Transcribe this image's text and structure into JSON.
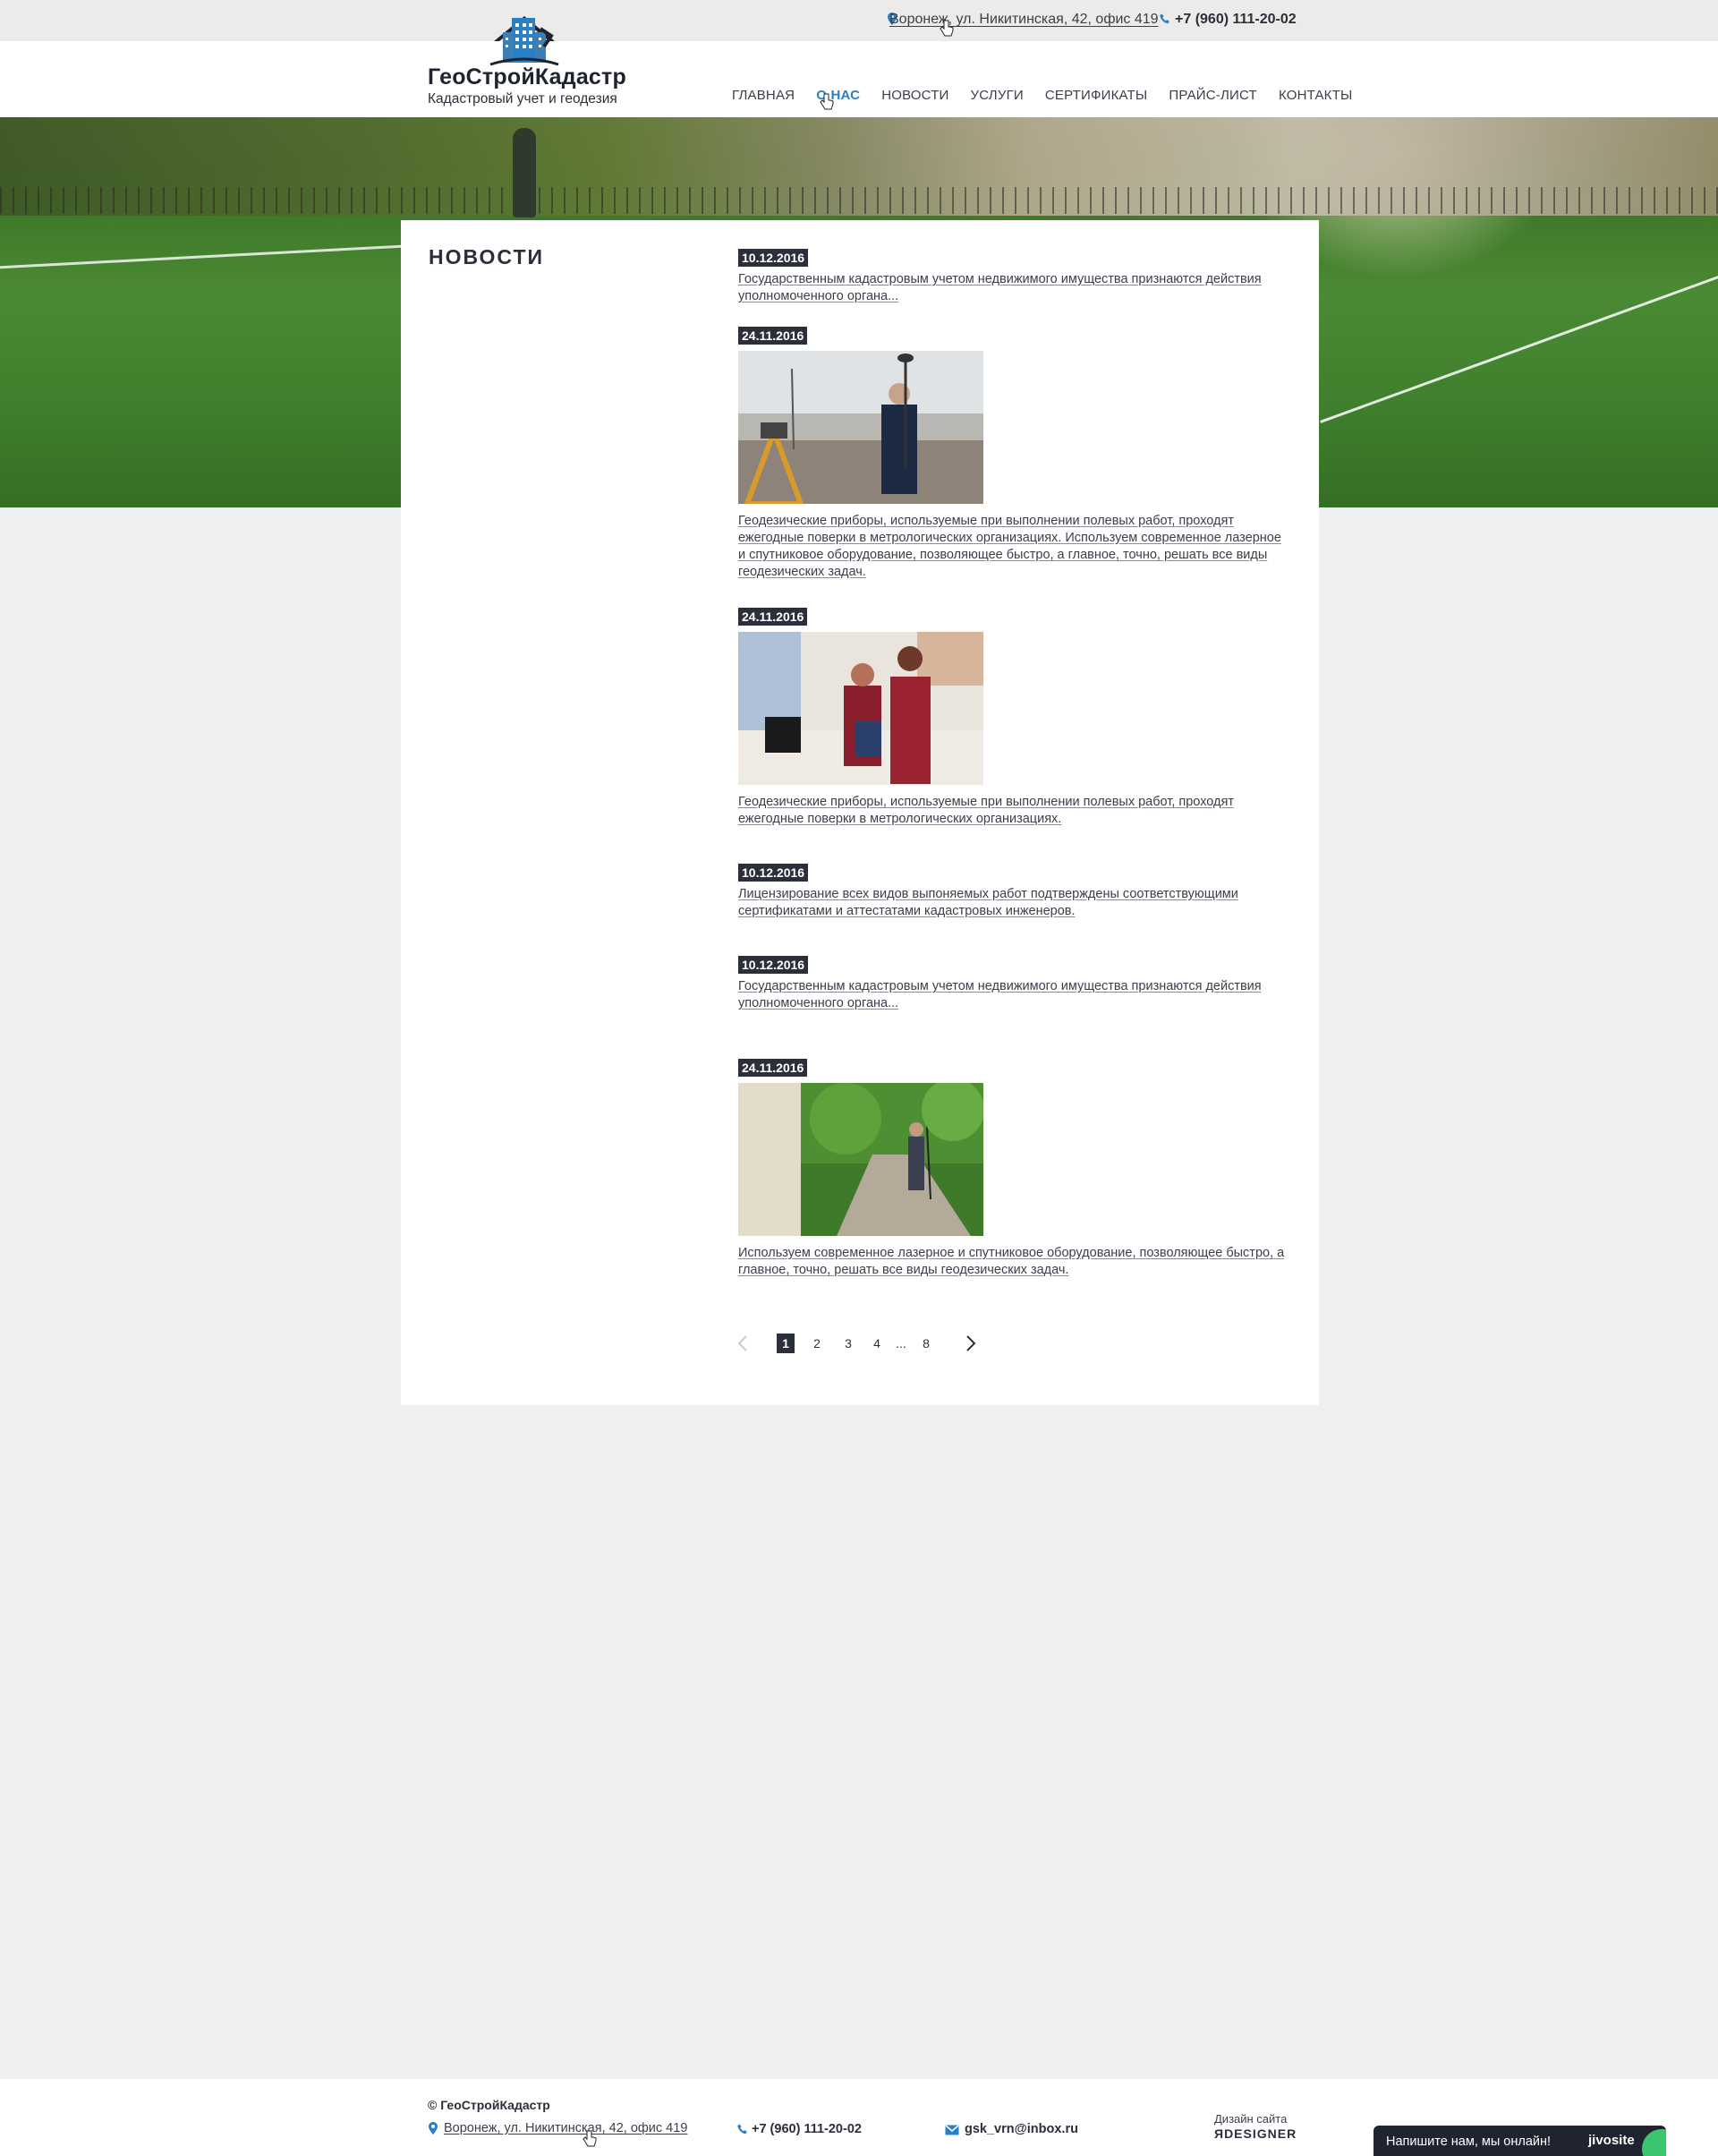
{
  "topbar": {
    "address": "Воронеж, ул. Никитинская, 42, офис 419",
    "phone": "+7 (960) 111-20-02"
  },
  "header": {
    "logo_name": "ГеоСтройКадастр",
    "logo_tagline": "Кадастровый учет и геодезия",
    "nav": [
      {
        "label": "ГЛАВНАЯ"
      },
      {
        "label": "О НАС",
        "active": true
      },
      {
        "label": "НОВОСТИ"
      },
      {
        "label": "УСЛУГИ"
      },
      {
        "label": "СЕРТИФИКАТЫ"
      },
      {
        "label": "ПРАЙС-ЛИСТ"
      },
      {
        "label": "КОНТАКТЫ"
      }
    ]
  },
  "main": {
    "title": "НОВОСТИ",
    "news": [
      {
        "date": "10.12.2016",
        "text": "Государственным кадастровым учетом недвижимого имущества  признаются действия уполномоченного органа...",
        "has_photo": false
      },
      {
        "date": "24.11.2016",
        "text": "Геодезические приборы, используемые при выполнении полевых работ, проходят ежегодные поверки в метрологических организациях. Используем современное лазерное и спутниковое оборудование, позволяющее быстро, а главное, точно, решать все виды геодезических задач.",
        "has_photo": true
      },
      {
        "date": "24.11.2016",
        "text": "Геодезические приборы, используемые при выполнении полевых работ, проходят ежегодные поверки в метрологических организациях.",
        "has_photo": true
      },
      {
        "date": "10.12.2016",
        "text": "Лицензирование всех видов выпоняемых работ подтверждены соответствующими сертификатами и аттестатами кадастровых инженеров.",
        "has_photo": false
      },
      {
        "date": "10.12.2016",
        "text": "Государственным кадастровым учетом недвижимого имущества  признаются действия уполномоченного органа...",
        "has_photo": false
      },
      {
        "date": "24.11.2016",
        "text": "Используем современное лазерное и спутниковое оборудование, позволяющее быстро, а главное, точно, решать все виды геодезических задач.",
        "has_photo": true
      }
    ],
    "pagination": {
      "prev": "‹",
      "pages": [
        "1",
        "2",
        "3",
        "4"
      ],
      "ellipsis": "...",
      "last": "8",
      "next": "›",
      "current": "1"
    }
  },
  "footer": {
    "copyright": "© ГеоСтройКадастр",
    "address": "Воронеж, ул. Никитинская, 42, офис 419",
    "phone": "+7 (960) 111-20-02",
    "email": "gsk_vrn@inbox.ru",
    "design_label": "Дизайн сайта",
    "design_brand": "ЯDESIGNER"
  },
  "chat": {
    "message": "Напишите нам, мы онлайн!",
    "brand": "jivosite"
  },
  "colors": {
    "accent": "#2980c4",
    "dark": "#2b2f3a",
    "page_bg": "#eef0f1"
  }
}
